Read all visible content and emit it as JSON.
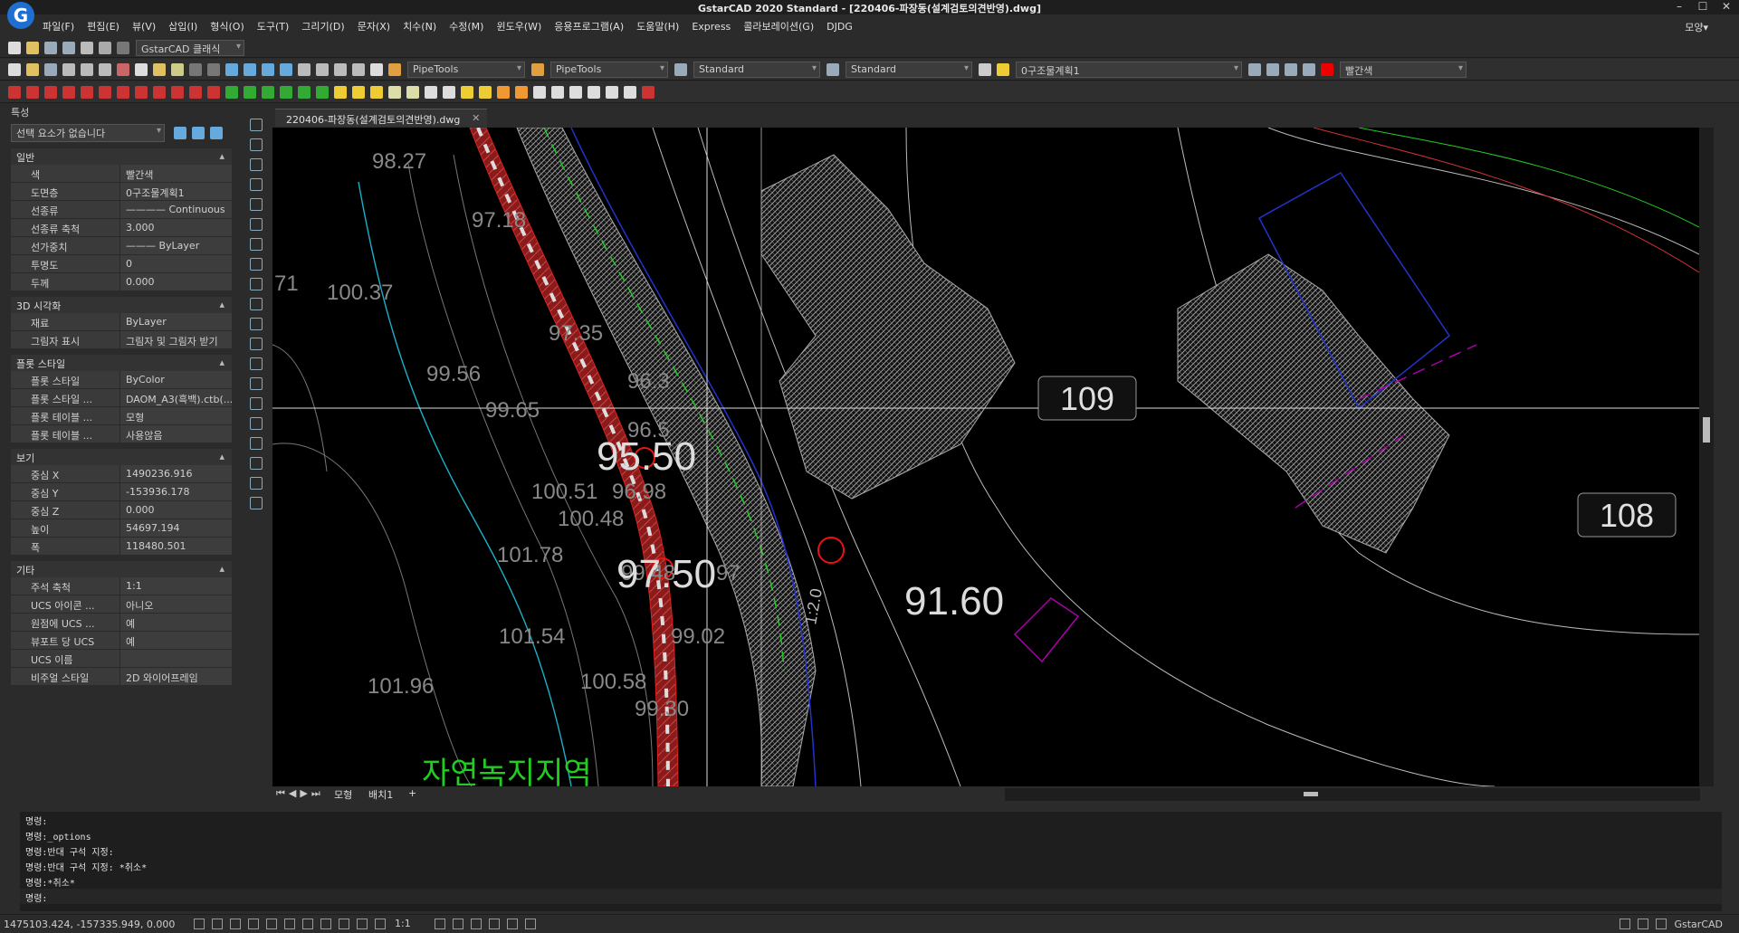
{
  "window": {
    "title": "GstarCAD 2020 Standard - [220406-파장동(설계검토의견반영).dwg]",
    "min": "–",
    "max": "☐",
    "close": "✕"
  },
  "logo_letter": "G",
  "menu": {
    "items": [
      "파일(F)",
      "편집(E)",
      "뷰(V)",
      "삽입(I)",
      "형식(O)",
      "도구(T)",
      "그리기(D)",
      "문자(X)",
      "치수(N)",
      "수정(M)",
      "윈도우(W)",
      "응용프로그램(A)",
      "도움말(H)",
      "Express",
      "콜라보레이션(G)",
      "DJDG"
    ],
    "right": "모양▾"
  },
  "quick_access": {
    "workspace": "GstarCAD 클래식"
  },
  "toolbar2": {
    "pipetools1": "PipeTools",
    "pipetools2": "PipeTools",
    "textstyle": "Standard",
    "dimstyle": "Standard",
    "layer": "0구조물계획1",
    "color": "빨간색"
  },
  "props": {
    "header": "특성",
    "selection": "선택 요소가 없습니다",
    "sections": [
      {
        "title": "일반",
        "rows": [
          {
            "k": "색",
            "v": "빨간색"
          },
          {
            "k": "도면층",
            "v": "0구조물계획1"
          },
          {
            "k": "선종류",
            "v": "———— Continuous"
          },
          {
            "k": "선종류 축척",
            "v": "3.000"
          },
          {
            "k": "선가중치",
            "v": "——— ByLayer"
          },
          {
            "k": "투명도",
            "v": "0"
          },
          {
            "k": "두께",
            "v": "0.000"
          }
        ]
      },
      {
        "title": "3D 시각화",
        "rows": [
          {
            "k": "재료",
            "v": "ByLayer"
          },
          {
            "k": "그림자 표시",
            "v": "그림자 및 그림자 받기"
          }
        ]
      },
      {
        "title": "플롯 스타일",
        "rows": [
          {
            "k": "플롯 스타일",
            "v": "ByColor"
          },
          {
            "k": "플롯 스타일 ...",
            "v": "DAOM_A3(흑백).ctb(..."
          },
          {
            "k": "플롯 테이블 ...",
            "v": "모형"
          },
          {
            "k": "플롯 테이블 ...",
            "v": "사용않음"
          }
        ]
      },
      {
        "title": "보기",
        "rows": [
          {
            "k": "중심 X",
            "v": "1490236.916"
          },
          {
            "k": "중심 Y",
            "v": "-153936.178"
          },
          {
            "k": "중심 Z",
            "v": "0.000"
          },
          {
            "k": "높이",
            "v": "54697.194"
          },
          {
            "k": "폭",
            "v": "118480.501"
          }
        ]
      },
      {
        "title": "기타",
        "rows": [
          {
            "k": "주석 축척",
            "v": "1:1"
          },
          {
            "k": "UCS 아이콘 ...",
            "v": "아니오"
          },
          {
            "k": "원점에 UCS ...",
            "v": "예"
          },
          {
            "k": "뷰포트 당 UCS",
            "v": "예"
          },
          {
            "k": "UCS 이름",
            "v": ""
          },
          {
            "k": "비주얼 스타일",
            "v": "2D 와이어프레임"
          }
        ]
      }
    ]
  },
  "doc_tab": {
    "label": "220406-파장동(설계검토의견반영).dwg",
    "close": "✕"
  },
  "drawing": {
    "labels_small": [
      "98.27",
      "97.18",
      "100.37",
      "97.35",
      "99.56",
      "99.65",
      "96.3",
      "96.5",
      "100.51",
      "96.98",
      "100.48",
      "101.78",
      "99.48",
      "97",
      "101.54",
      "99.02",
      "101.96",
      "100.58",
      "99.30",
      "71",
      "1:2.0"
    ],
    "labels_big": [
      "95.50",
      "97.50",
      "91.60"
    ],
    "buildings": [
      "109",
      "108"
    ],
    "zone": "자연녹지지역"
  },
  "layouts": {
    "nav": "⏮◀▶⏭",
    "model": "모형",
    "layout1": "배치1",
    "add": "+"
  },
  "command": {
    "lines": [
      "명령:",
      "명령:_options",
      "명령:반대 구석 지정:",
      "명령:반대 구석 지정: *취소*",
      "명령:*취소*",
      "명령:"
    ]
  },
  "status": {
    "coords": "1475103.424, -157335.949, 0.000",
    "scale": "1:1",
    "app": "GstarCAD"
  }
}
